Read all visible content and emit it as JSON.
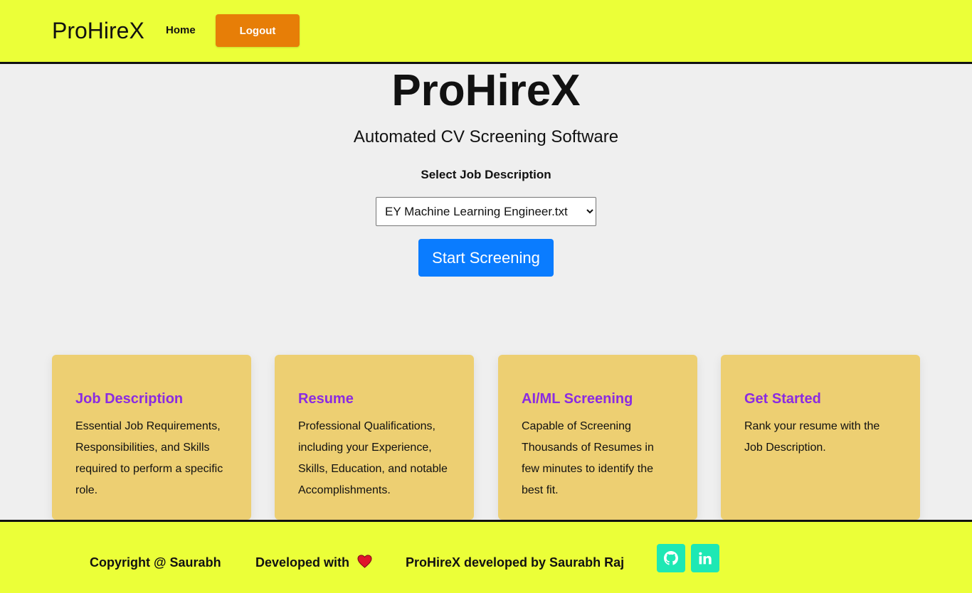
{
  "header": {
    "brand": "ProHireX",
    "nav_home": "Home",
    "logout_label": "Logout"
  },
  "hero": {
    "title": "ProHireX",
    "subtitle": "Automated CV Screening Software",
    "select_label": "Select Job Description",
    "selected_option": "EY Machine Learning Engineer.txt",
    "start_button": "Start Screening"
  },
  "cards": [
    {
      "title": "Job Description",
      "text": "Essential Job Requirements, Responsibilities, and Skills required to perform a specific role."
    },
    {
      "title": "Resume",
      "text": "Professional Qualifications, including your Experience, Skills, Education, and notable Accomplishments."
    },
    {
      "title": "AI/ML Screening",
      "text": "Capable of Screening Thousands of Resumes in few minutes to identify the best fit."
    },
    {
      "title": "Get Started",
      "text": "Rank your resume with the Job Description."
    }
  ],
  "footer": {
    "copyright": "Copyright @ Saurabh",
    "developed_with": "Developed with",
    "credit": "ProHireX developed by Saurabh Raj",
    "icons": [
      "github-icon",
      "linkedin-icon",
      "heart-icon"
    ]
  },
  "colors": {
    "header_bg": "#ebff38",
    "logout_bg": "#e77e07",
    "primary_button": "#0a7cff",
    "card_bg": "#edcf72",
    "card_title": "#8a2be2",
    "social_bg": "#1ee8b4"
  }
}
